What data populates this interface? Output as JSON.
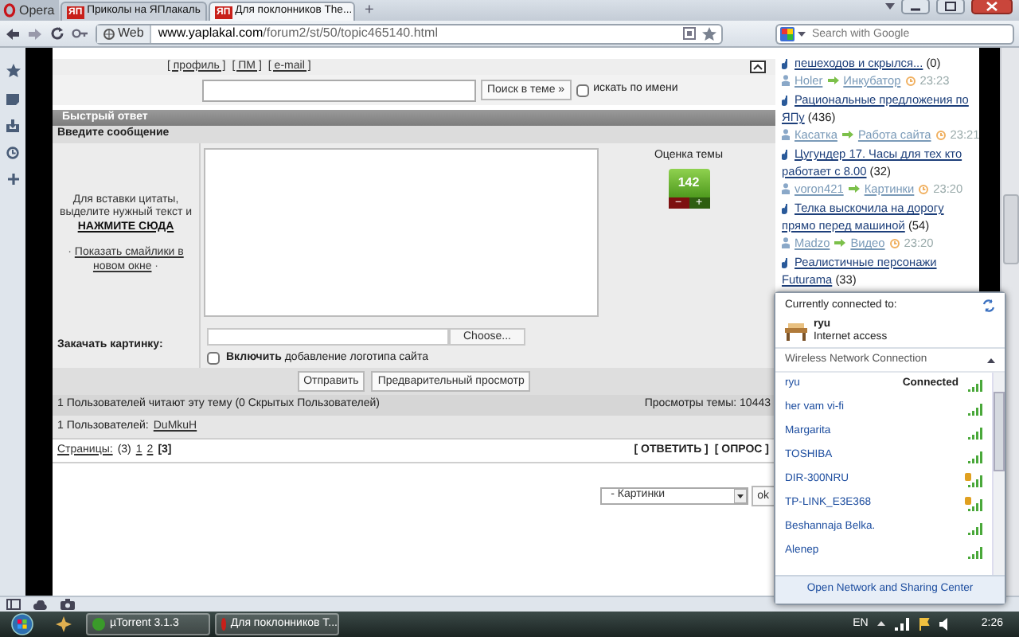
{
  "browser": {
    "menu_button": "Opera",
    "tabs": [
      {
        "icon": "ЯП",
        "label": "Приколы на ЯПлакаль",
        "selected": false
      },
      {
        "icon": "ЯП",
        "label": "Для поклонников The...",
        "selected": true
      }
    ],
    "new_tab": "+",
    "address": {
      "badge": "Web",
      "host": "www.yaplakal.com",
      "path": "/forum2/st/50/topic465140.html"
    },
    "search": {
      "placeholder": "Search with Google"
    }
  },
  "page": {
    "profile_links": [
      "[ профиль ]",
      "[ ПМ ]",
      "[ e-mail ]"
    ],
    "search": {
      "button": "Поиск в теме »",
      "checkbox_label": "искать по имени",
      "checked": false
    },
    "quick_reply": {
      "title": "Быстрый ответ",
      "subtitle": "Введите сообщение",
      "hint": "Для вставки цитаты, выделите нужный текст и",
      "hint_link": "НАЖМИТЕ СЮДА",
      "smilies": {
        "before": "·",
        "link": "Показать смайлики в новом окне",
        "after": "·"
      },
      "rating": {
        "title": "Оценка темы",
        "value": "142",
        "minus": "−",
        "plus": "+"
      },
      "upload": {
        "label": "Закачать картинку:",
        "button": "Choose...",
        "checked": false,
        "option": "**Включить** добавление логотипа сайта"
      },
      "buttons": [
        "Отправить",
        "Предварительный просмотр"
      ]
    },
    "readers": "1 Пользователей читают эту тему (0 Скрытых Пользователей)",
    "views": "Просмотры темы: 10443",
    "users_label": "1 Пользователей:",
    "users": [
      "DuMkuH"
    ],
    "pages": {
      "label": "Страницы:",
      "count": "(3)",
      "items": [
        {
          "label": "1",
          "selected": false
        },
        {
          "label": "2",
          "selected": false
        },
        {
          "label": "[3]",
          "selected": true
        }
      ]
    },
    "actions": [
      "[ ОТВЕТИТЬ ]",
      "[ ОПРОС ]"
    ],
    "jump": {
      "value": "- Картинки",
      "button": "ok"
    }
  },
  "news": [
    {
      "title": "пешеходов и скрылся...",
      "count": "(0)",
      "author": "Holer",
      "section": "Инкубатор",
      "time": "23:23"
    },
    {
      "title": "Рациональные предложения по ЯПу",
      "count": "(436)",
      "author": "Касатка",
      "section": "Работа сайта",
      "time": "23:21"
    },
    {
      "title": "Цугундер 17. Часы для тех кто работает с 8.00",
      "count": "(32)",
      "author": "voron421",
      "section": "Картинки",
      "time": "23:20"
    },
    {
      "title": "Телка выскочила на дорогу прямо перед машиной",
      "count": "(54)",
      "author": "Madzo",
      "section": "Видео",
      "time": "23:20"
    },
    {
      "title": "Реалистичные персонажи Futurama",
      "count": "(33)"
    }
  ],
  "flyout": {
    "heading": "Currently connected to:",
    "network": {
      "name": "ryu",
      "status": "Internet access"
    },
    "section": "Wireless Network Connection",
    "networks": [
      {
        "name": "ryu",
        "status": "Connected",
        "secured": false
      },
      {
        "name": "her vam vi-fi",
        "secured": false
      },
      {
        "name": "Margarita",
        "secured": false
      },
      {
        "name": "TOSHIBA",
        "secured": false
      },
      {
        "name": "DIR-300NRU",
        "secured": true
      },
      {
        "name": "TP-LINK_E3E368",
        "secured": true
      },
      {
        "name": "Beshannaja Belka.",
        "secured": false
      },
      {
        "name": "Alenep",
        "secured": false
      }
    ],
    "footer": "Open Network and Sharing Center"
  },
  "taskbar": {
    "items": [
      {
        "label": "µTorrent 3.1.3",
        "color": "#3a9a2a"
      },
      {
        "label": "Для поклонников T...",
        "color": "#c8201a"
      }
    ],
    "language": "EN",
    "clock": "2:26"
  }
}
